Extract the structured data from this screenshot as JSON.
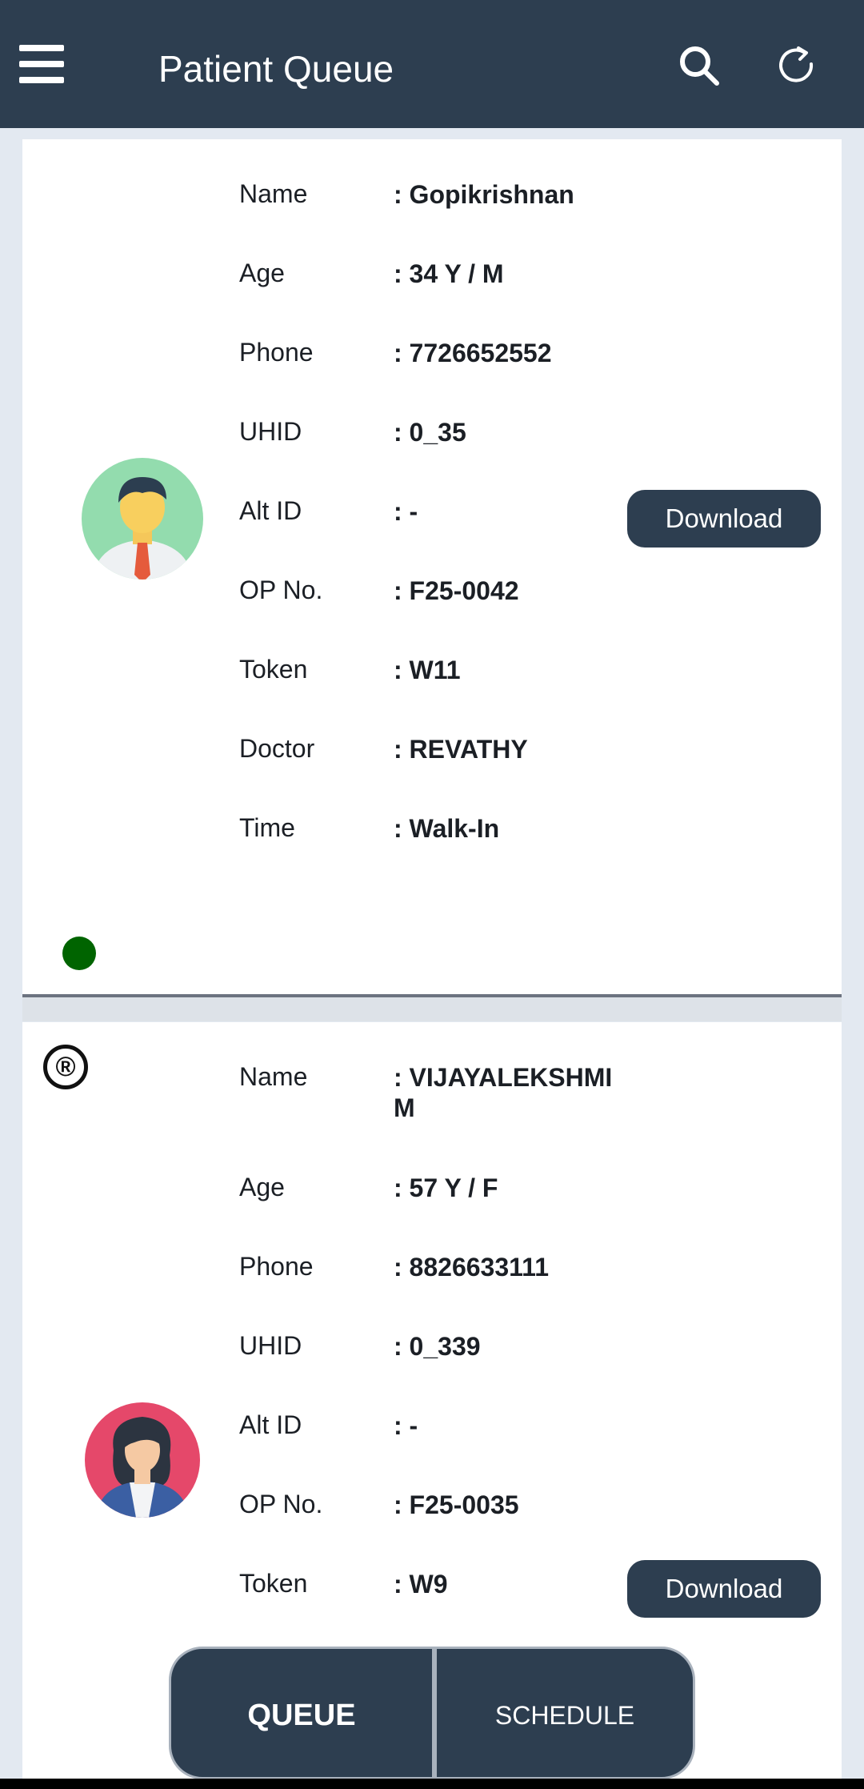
{
  "appbar": {
    "title": "Patient Queue",
    "icons": {
      "menu": "menu-icon",
      "search": "search-icon",
      "refresh": "refresh-icon"
    }
  },
  "field_labels": {
    "name": "Name",
    "age": "Age",
    "phone": "Phone",
    "uhid": "UHID",
    "alt_id": "Alt ID",
    "op_no": "OP No.",
    "token": "Token",
    "doctor": "Doctor",
    "time": "Time"
  },
  "patients": [
    {
      "name": ": Gopikrishnan",
      "age": ": 34 Y / M",
      "phone": ": 7726652552",
      "uhid": ": 0_35",
      "alt_id": ": -",
      "op_no": ": F25-0042",
      "token": ": W11",
      "doctor": ": REVATHY",
      "time": ": Walk-In",
      "download_label": "Download",
      "avatar": "male-avatar-icon",
      "status_color": "#006400"
    },
    {
      "badge": "®",
      "name": ": VIJAYALEKSHMI M",
      "age": ": 57 Y / F",
      "phone": ": 8826633111",
      "uhid": ": 0_339",
      "alt_id": ": -",
      "op_no": ": F25-0035",
      "token": ": W9",
      "download_label": "Download",
      "avatar": "female-avatar-icon"
    }
  ],
  "bottom_nav": {
    "queue_label": "QUEUE",
    "schedule_label": "SCHEDULE",
    "active": "QUEUE"
  },
  "colors": {
    "primary": "#2d3e50",
    "background": "#e3e9f1",
    "status_active": "#006400"
  }
}
